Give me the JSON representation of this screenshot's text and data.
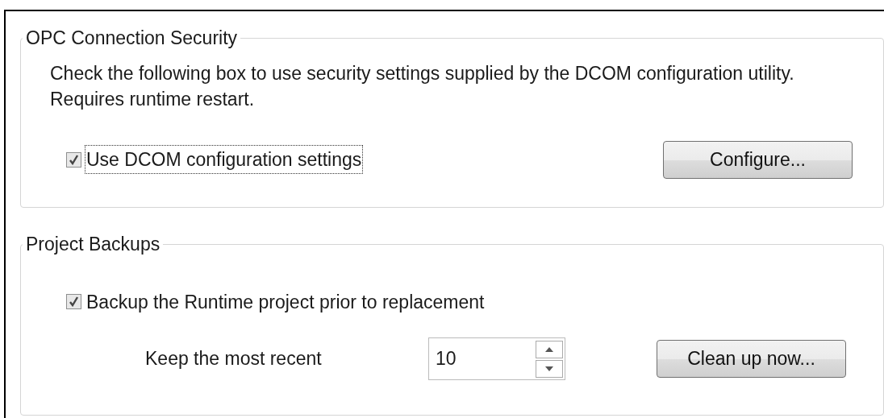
{
  "groups": [
    {
      "title": "OPC Connection Security",
      "description": "Check the following box to use security settings supplied by the DCOM configuration utility.  Requires runtime restart.",
      "checkbox": {
        "label": "Use DCOM configuration settings",
        "checked": true,
        "focused": true
      },
      "button": "Configure..."
    },
    {
      "title": "Project Backups",
      "checkbox": {
        "label": "Backup the Runtime project prior to replacement",
        "checked": true,
        "focused": false
      },
      "spinner": {
        "label": "Keep the most recent",
        "value": "10"
      },
      "button": "Clean up now..."
    }
  ]
}
